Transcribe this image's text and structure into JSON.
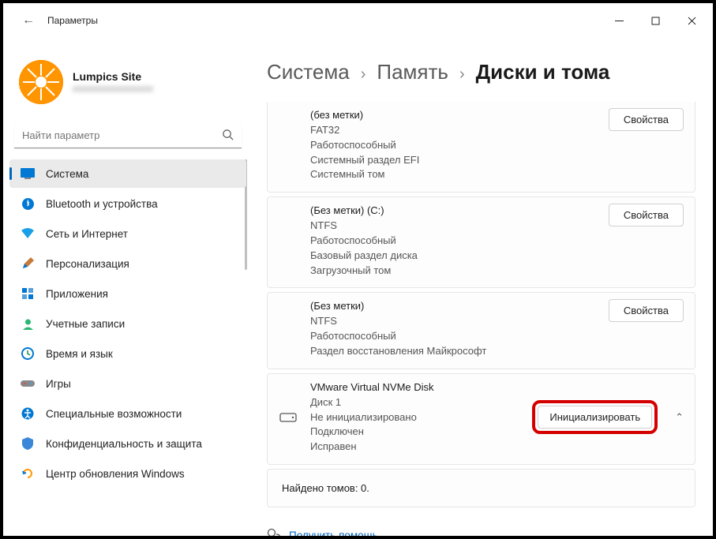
{
  "window": {
    "title": "Параметры"
  },
  "profile": {
    "name": "Lumpics Site",
    "email": "xxxxxxxxxxxxxxxxx"
  },
  "search": {
    "placeholder": "Найти параметр"
  },
  "nav": [
    {
      "label": "Система"
    },
    {
      "label": "Bluetooth и устройства"
    },
    {
      "label": "Сеть и Интернет"
    },
    {
      "label": "Персонализация"
    },
    {
      "label": "Приложения"
    },
    {
      "label": "Учетные записи"
    },
    {
      "label": "Время и язык"
    },
    {
      "label": "Игры"
    },
    {
      "label": "Специальные возможности"
    },
    {
      "label": "Конфиденциальность и защита"
    },
    {
      "label": "Центр обновления Windows"
    }
  ],
  "breadcrumb": {
    "a": "Система",
    "b": "Память",
    "c": "Диски и тома"
  },
  "volumes": [
    {
      "title": "(без метки)",
      "fs": "FAT32",
      "l1": "Работоспособный",
      "l2": "Системный раздел EFI",
      "l3": "Системный том",
      "btn": "Свойства"
    },
    {
      "title": "(Без метки) (C:)",
      "fs": "NTFS",
      "l1": "Работоспособный",
      "l2": "Базовый раздел диска",
      "l3": "Загрузочный том",
      "btn": "Свойства"
    },
    {
      "title": "(Без метки)",
      "fs": "NTFS",
      "l1": "Работоспособный",
      "l2": "Раздел восстановления Майкрософт",
      "l3": "",
      "btn": "Свойства"
    }
  ],
  "disk": {
    "name": "VMware Virtual NVMe Disk",
    "sub": "Диск 1",
    "l1": "Не инициализировано",
    "l2": "Подключен",
    "l3": "Исправен",
    "btn": "Инициализировать"
  },
  "found": "Найдено томов: 0.",
  "help": "Получить помощь"
}
